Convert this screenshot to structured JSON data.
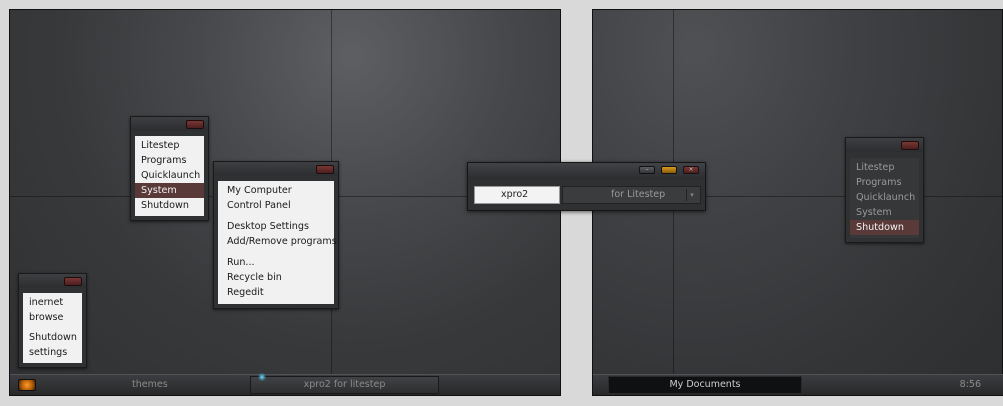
{
  "menus": {
    "main": [
      "Litestep",
      "Programs",
      "Quicklaunch",
      "System",
      "Shutdown"
    ],
    "system": [
      "My Computer",
      "Control Panel",
      "Desktop Settings",
      "Add/Remove programs",
      "Run...",
      "Recycle bin",
      "Regedit"
    ],
    "small": [
      "inernet",
      "browse",
      "Shutdown",
      "settings"
    ],
    "right": [
      "Litestep",
      "Programs",
      "Quicklaunch",
      "System",
      "Shutdown"
    ]
  },
  "dialog": {
    "input_value": "xpro2",
    "select_value": "for Litestep"
  },
  "taskbar_left": {
    "themes": "themes",
    "task": "xpro2 for litestep"
  },
  "taskbar_right": {
    "task": "My Documents",
    "clock": "8:56"
  },
  "colors": {
    "accent_selected": "#5a3a38",
    "close_button": "#6a2c2c",
    "orb": "#ff9b2a"
  }
}
